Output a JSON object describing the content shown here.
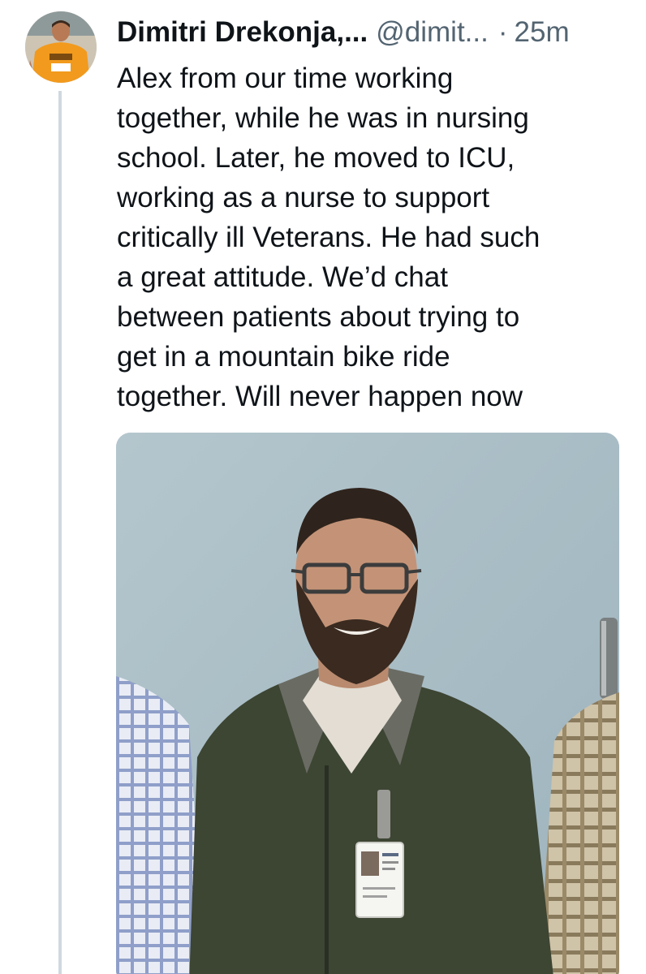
{
  "tweet": {
    "display_name": "Dimitri Drekonja,...",
    "handle": "@dimit...",
    "separator": "·",
    "timestamp": "25m",
    "text_lines": [
      "Alex from our time working",
      "together, while he was in nursing",
      "school. Later, he moved to ICU,",
      "working as a nurse to support",
      "critically ill Veterans. He had such",
      "a great attitude. We’d chat",
      "between patients about trying to",
      "get in a mountain bike ride",
      "together. Will never happen now"
    ]
  },
  "icons": {
    "avatar": "profile-photo-runner-orange-shirt",
    "media": "photo-man-glasses-beard-green-jacket"
  },
  "colors": {
    "text_primary": "#0f1419",
    "text_secondary": "#536471",
    "thread_line": "#cfd9de",
    "avatar_shirt": "#f29a1d",
    "photo_wall": "#a9bcc4",
    "jacket": "#3d4533"
  }
}
